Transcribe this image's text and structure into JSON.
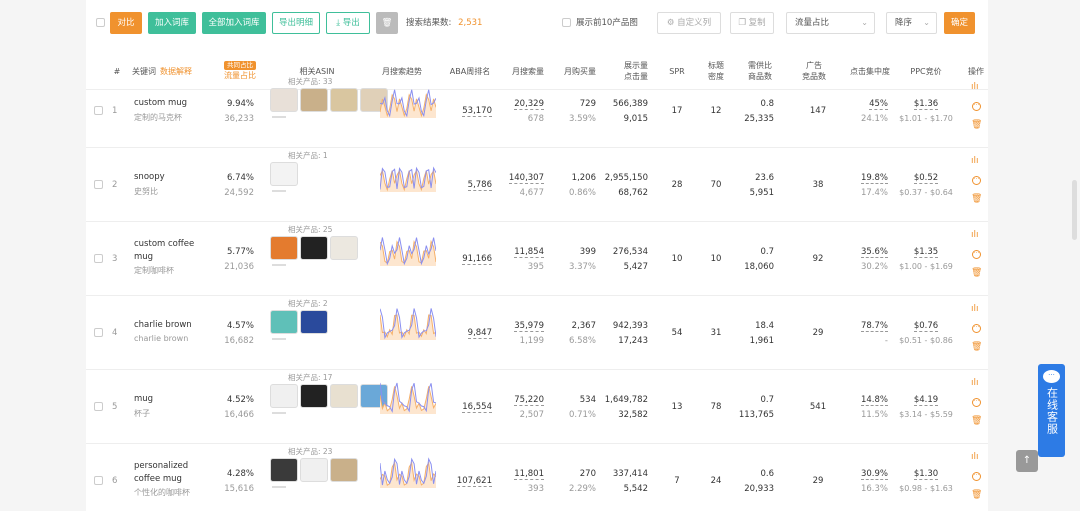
{
  "toolbar": {
    "compare": "对比",
    "add_to_lib": "加入词库",
    "add_all_to_lib": "全部加入词库",
    "export_detail": "导出明细",
    "export": "导出",
    "result_label": "搜索结果数:",
    "result_count": "2,531",
    "show_top10": "展示前10产品图",
    "custom_columns": "自定义列",
    "copy": "复制",
    "sort_field": "流量占比",
    "sort_order": "降序",
    "confirm": "确定"
  },
  "headers": {
    "index": "#",
    "keyword": "关键词",
    "data_explain": "数据解释",
    "traffic_badge": "共同占比",
    "traffic": "流量占比",
    "related_asin": "相关ASIN",
    "monthly_trend": "月搜索趋势",
    "aba_rank": "ABA周排名",
    "monthly_search": "月搜索量",
    "monthly_purchase": "月购买量",
    "impressions_line1": "展示量",
    "impressions_line2": "点击量",
    "spr": "SPR",
    "title_density_line1": "标题",
    "title_density_line2": "密度",
    "supply_demand_line1": "需供比",
    "supply_demand_line2": "商品数",
    "ads_line1": "广告",
    "ads_line2": "竞品数",
    "click_concentration": "点击集中度",
    "ppc": "PPC竞价",
    "actions": "操作"
  },
  "rows": [
    {
      "index": "1",
      "keyword": "custom mug",
      "keyword_line2": "",
      "keyword_cn": "定制的马克杯",
      "traffic": "9.94%",
      "traffic_sub": "36,233",
      "related_label": "相关产品: 33",
      "aba_rank": "53,170",
      "search": "20,329",
      "search_sub": "678",
      "purchase": "729",
      "purchase_rate": "3.59%",
      "impressions": "566,389",
      "clicks": "9,015",
      "spr": "17",
      "title_density": "12",
      "sd_ratio": "0.8",
      "products": "25,335",
      "ads": "147",
      "click_conc": "45%",
      "click_conc_sub": "24.1%",
      "ppc": "$1.36",
      "ppc_range": "$1.01 - $1.70"
    },
    {
      "index": "2",
      "keyword": "snoopy",
      "keyword_line2": "",
      "keyword_cn": "史努比",
      "traffic": "6.74%",
      "traffic_sub": "24,592",
      "related_label": "相关产品: 1",
      "aba_rank": "5,786",
      "search": "140,307",
      "search_sub": "4,677",
      "purchase": "1,206",
      "purchase_rate": "0.86%",
      "impressions": "2,955,150",
      "clicks": "68,762",
      "spr": "28",
      "title_density": "70",
      "sd_ratio": "23.6",
      "products": "5,951",
      "ads": "38",
      "click_conc": "19.8%",
      "click_conc_sub": "17.4%",
      "ppc": "$0.52",
      "ppc_range": "$0.37 - $0.64"
    },
    {
      "index": "3",
      "keyword": "custom coffee",
      "keyword_line2": "mug",
      "keyword_cn": "定制咖啡杯",
      "traffic": "5.77%",
      "traffic_sub": "21,036",
      "related_label": "相关产品: 25",
      "aba_rank": "91,166",
      "search": "11,854",
      "search_sub": "395",
      "purchase": "399",
      "purchase_rate": "3.37%",
      "impressions": "276,534",
      "clicks": "5,427",
      "spr": "10",
      "title_density": "10",
      "sd_ratio": "0.7",
      "products": "18,060",
      "ads": "92",
      "click_conc": "35.6%",
      "click_conc_sub": "30.2%",
      "ppc": "$1.35",
      "ppc_range": "$1.00 - $1.69"
    },
    {
      "index": "4",
      "keyword": "charlie brown",
      "keyword_line2": "",
      "keyword_cn": "charlie brown",
      "traffic": "4.57%",
      "traffic_sub": "16,682",
      "related_label": "相关产品: 2",
      "aba_rank": "9,847",
      "search": "35,979",
      "search_sub": "1,199",
      "purchase": "2,367",
      "purchase_rate": "6.58%",
      "impressions": "942,393",
      "clicks": "17,243",
      "spr": "54",
      "title_density": "31",
      "sd_ratio": "18.4",
      "products": "1,961",
      "ads": "29",
      "click_conc": "78.7%",
      "click_conc_sub": "-",
      "ppc": "$0.76",
      "ppc_range": "$0.51 - $0.86"
    },
    {
      "index": "5",
      "keyword": "mug",
      "keyword_line2": "",
      "keyword_cn": "杯子",
      "traffic": "4.52%",
      "traffic_sub": "16,466",
      "related_label": "相关产品: 17",
      "aba_rank": "16,554",
      "search": "75,220",
      "search_sub": "2,507",
      "purchase": "534",
      "purchase_rate": "0.71%",
      "impressions": "1,649,782",
      "clicks": "32,582",
      "spr": "13",
      "title_density": "78",
      "sd_ratio": "0.7",
      "products": "113,765",
      "ads": "541",
      "click_conc": "14.8%",
      "click_conc_sub": "11.5%",
      "ppc": "$4.19",
      "ppc_range": "$3.14 - $5.59"
    },
    {
      "index": "6",
      "keyword": "personalized",
      "keyword_line2": "coffee mug",
      "keyword_cn": "个性化的咖啡杯",
      "traffic": "4.28%",
      "traffic_sub": "15,616",
      "related_label": "相关产品: 23",
      "aba_rank": "107,621",
      "search": "11,801",
      "search_sub": "393",
      "purchase": "270",
      "purchase_rate": "2.29%",
      "impressions": "337,414",
      "clicks": "5,542",
      "spr": "7",
      "title_density": "24",
      "sd_ratio": "0.6",
      "products": "20,933",
      "ads": "29",
      "click_conc": "30.9%",
      "click_conc_sub": "16.3%",
      "ppc": "$1.30",
      "ppc_range": "$0.98 - $1.63"
    }
  ],
  "side_service": "在线客服",
  "colors": {
    "accent_orange": "#f0922e",
    "accent_green": "#3fbf9a",
    "spark_blue": "#8a8ff0",
    "spark_orange": "#f5b06a",
    "service_blue": "#2d7be5"
  }
}
